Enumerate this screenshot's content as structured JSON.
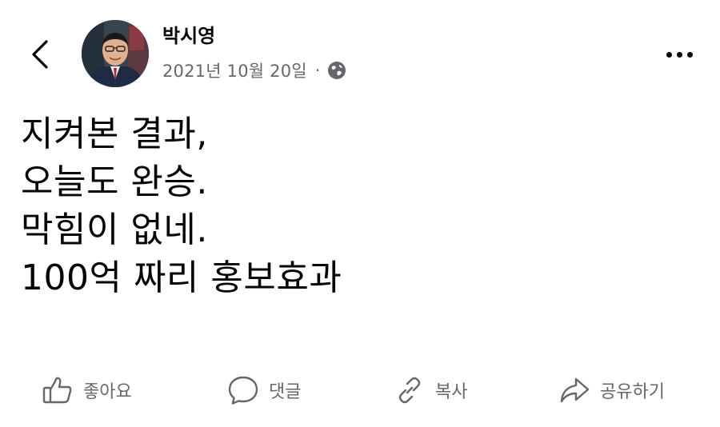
{
  "post": {
    "author": "박시영",
    "date": "2021년 10월 20일",
    "separator": "·",
    "privacy_icon": "globe-icon",
    "lines": [
      "지켜본 결과,",
      "오늘도 완승.",
      "막힘이 없네.",
      "100억 짜리 홍보효과"
    ]
  },
  "nav": {
    "back_icon": "chevron-left-icon",
    "more_icon": "more-horizontal-icon"
  },
  "actions": {
    "like": {
      "label": "좋아요",
      "icon": "thumbs-up-icon"
    },
    "comment": {
      "label": "댓글",
      "icon": "comment-bubble-icon"
    },
    "copy": {
      "label": "복사",
      "icon": "link-icon"
    },
    "share": {
      "label": "공유하기",
      "icon": "share-arrow-icon"
    }
  },
  "colors": {
    "text_primary": "#050505",
    "text_secondary": "#65676b",
    "background": "#ffffff"
  }
}
